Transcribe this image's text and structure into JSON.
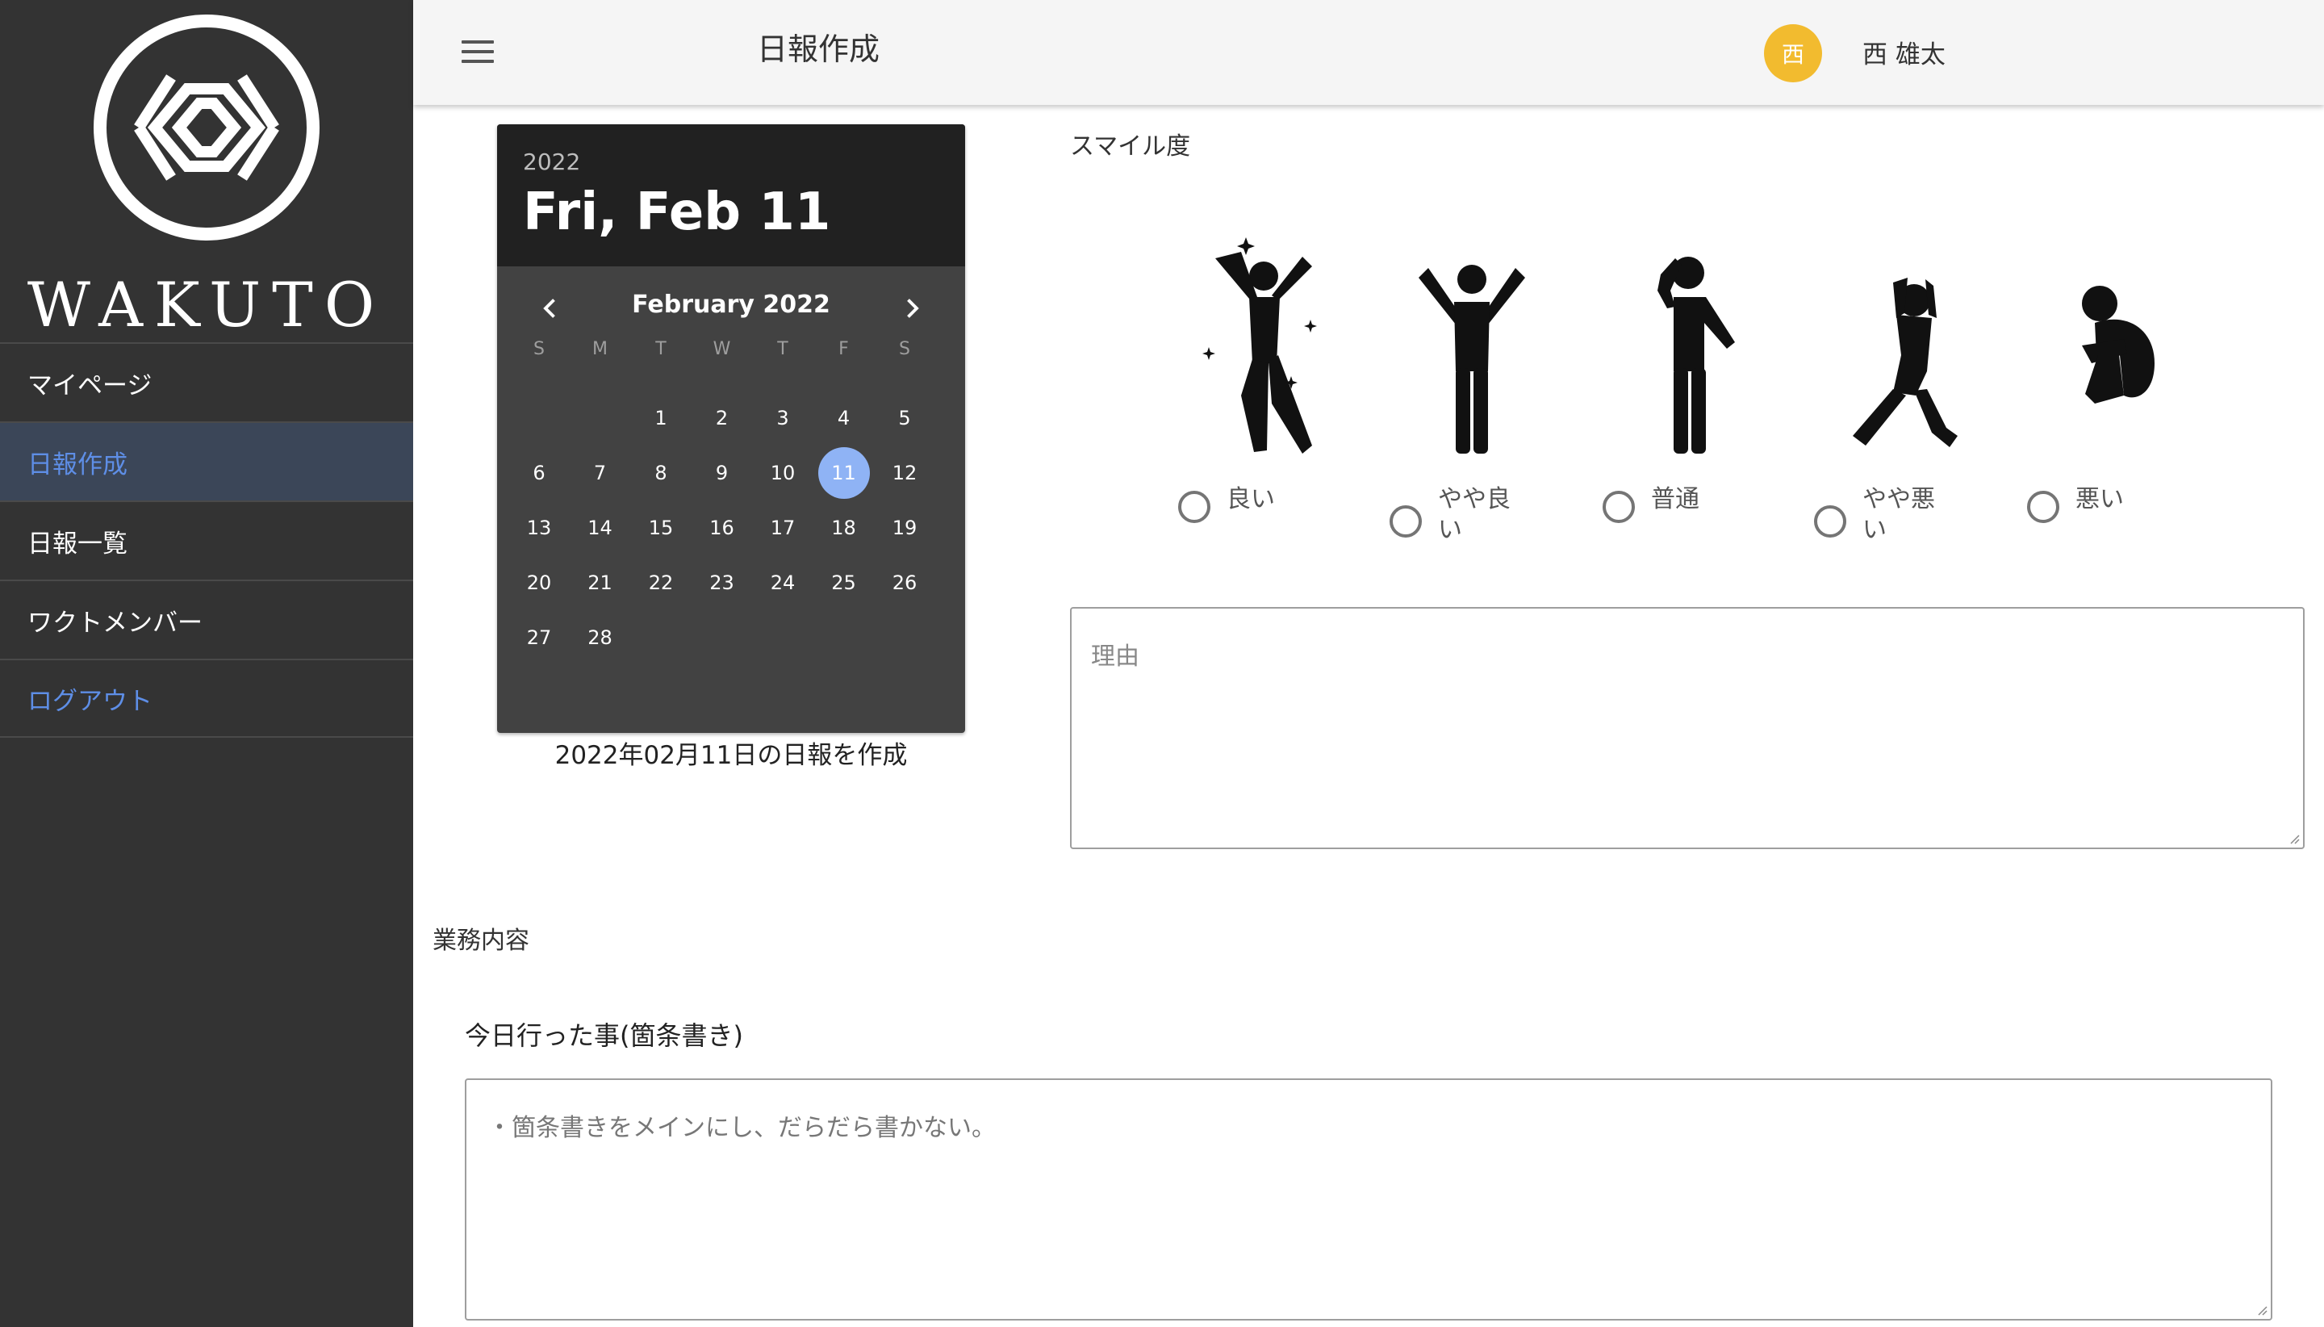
{
  "sidebar": {
    "logo_text": "WAKUTO",
    "items": [
      {
        "label": "マイページ"
      },
      {
        "label": "日報作成"
      },
      {
        "label": "日報一覧"
      },
      {
        "label": "ワクトメンバー"
      },
      {
        "label": "ログアウト"
      }
    ],
    "active_item": "日報作成"
  },
  "header": {
    "title": "日報作成",
    "avatar_initial": "西",
    "user_name": "西 雄太",
    "menu_icon": "hamburger-icon"
  },
  "date_picker": {
    "year": "2022",
    "selected_label": "Fri, Feb 11",
    "month_label": "February 2022",
    "weekdays": [
      "S",
      "M",
      "T",
      "W",
      "T",
      "F",
      "S"
    ],
    "first_weekday_index": 2,
    "days_in_month": 28,
    "selected_day": 11,
    "caption": "2022年02月11日の日報を作成"
  },
  "smile": {
    "label": "スマイル度",
    "options": [
      {
        "label": "良い",
        "icon": "jumping-joy-figure-icon"
      },
      {
        "label": "やや良い",
        "icon": "arms-raised-figure-icon"
      },
      {
        "label": "普通",
        "icon": "thinking-figure-icon"
      },
      {
        "label": "やや悪い",
        "icon": "head-in-hands-figure-icon"
      },
      {
        "label": "悪い",
        "icon": "crouching-figure-icon"
      }
    ],
    "selected": null
  },
  "reason": {
    "placeholder": "理由"
  },
  "work": {
    "label": "業務内容",
    "today_label": "今日行った事(箇条書き)",
    "today_placeholder": "・箇条書きをメインにし、だらだら書かない。"
  },
  "colors": {
    "sidebar_bg": "#333333",
    "active_bg": "#3b4658",
    "link_blue": "#5e8ee6",
    "avatar_bg": "#f2bb2f",
    "selected_day_bg": "#8fb3f5"
  }
}
